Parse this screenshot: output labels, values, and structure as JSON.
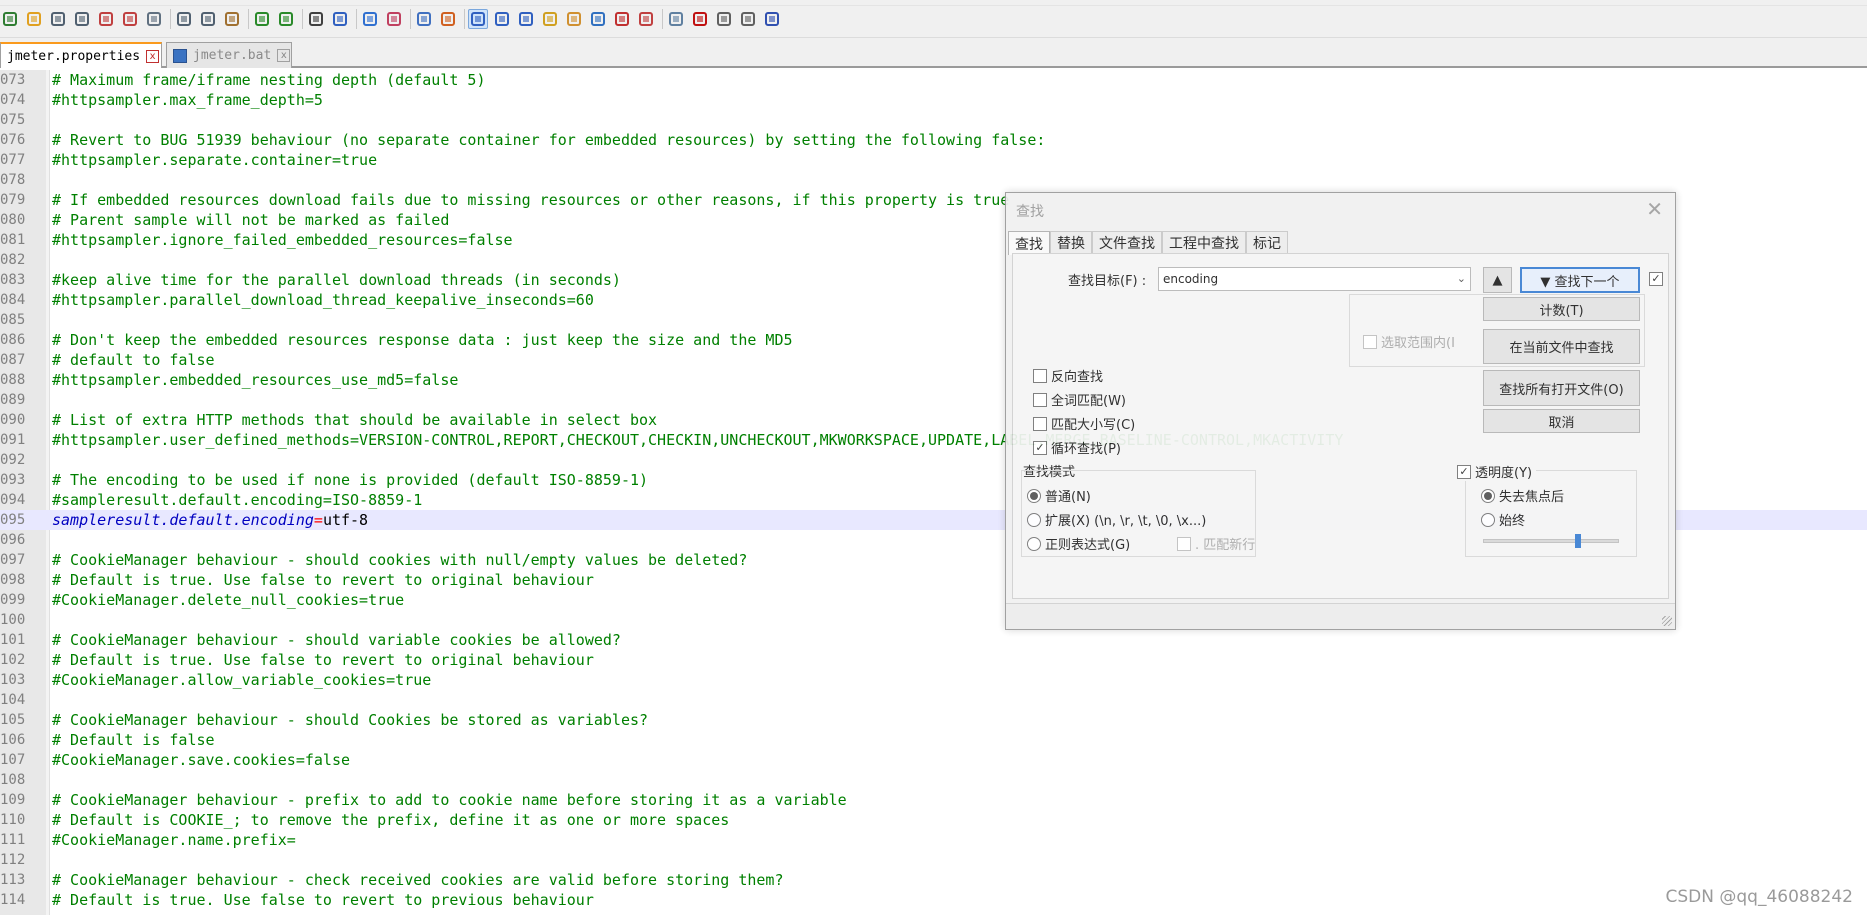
{
  "toolbar": {
    "icons": [
      "new-file-icon",
      "open-folder-icon",
      "save-icon",
      "save-all-icon",
      "close-icon",
      "close-all-icon",
      "print-icon",
      "cut-icon",
      "copy-icon",
      "paste-icon",
      "undo-icon",
      "redo-icon",
      "find-icon",
      "replace-icon",
      "zoom-in-icon",
      "zoom-out-icon",
      "sync-vertical-icon",
      "sync-horizontal-icon",
      "word-wrap-icon",
      "show-all-chars-icon",
      "indent-guide-icon",
      "language-icon",
      "doc-map-icon",
      "function-list-icon",
      "folder-workspace-icon",
      "monitor-icon",
      "record-macro-icon",
      "stop-macro-icon",
      "play-macro-icon",
      "run-macro-icon",
      "save-macro-icon"
    ]
  },
  "tabs": [
    {
      "label": "jmeter.properties",
      "active": true
    },
    {
      "label": "jmeter.bat",
      "active": false
    }
  ],
  "editor": {
    "lines": [
      {
        "n": "073",
        "text": "# Maximum frame/iframe nesting depth (default 5)"
      },
      {
        "n": "074",
        "text": "#httpsampler.max_frame_depth=5"
      },
      {
        "n": "075",
        "text": ""
      },
      {
        "n": "076",
        "text": "# Revert to BUG 51939 behaviour (no separate container for embedded resources) by setting the following false:"
      },
      {
        "n": "077",
        "text": "#httpsampler.separate.container=true"
      },
      {
        "n": "078",
        "text": ""
      },
      {
        "n": "079",
        "text": "# If embedded resources download fails due to missing resources or other reasons, if this property is true"
      },
      {
        "n": "080",
        "text": "# Parent sample will not be marked as failed"
      },
      {
        "n": "081",
        "text": "#httpsampler.ignore_failed_embedded_resources=false"
      },
      {
        "n": "082",
        "text": ""
      },
      {
        "n": "083",
        "text": "#keep alive time for the parallel download threads (in seconds)"
      },
      {
        "n": "084",
        "text": "#httpsampler.parallel_download_thread_keepalive_inseconds=60"
      },
      {
        "n": "085",
        "text": ""
      },
      {
        "n": "086",
        "text": "# Don't keep the embedded resources response data : just keep the size and the MD5"
      },
      {
        "n": "087",
        "text": "# default to false"
      },
      {
        "n": "088",
        "text": "#httpsampler.embedded_resources_use_md5=false"
      },
      {
        "n": "089",
        "text": ""
      },
      {
        "n": "090",
        "text": "# List of extra HTTP methods that should be available in select box"
      },
      {
        "n": "091",
        "text": "#httpsampler.user_defined_methods=VERSION-CONTROL,REPORT,CHECKOUT,CHECKIN,UNCHECKOUT,MKWORKSPACE,UPDATE,LABEL,MERGE,BASELINE-CONTROL,MKACTIVITY"
      },
      {
        "n": "092",
        "text": ""
      },
      {
        "n": "093",
        "text": "# The encoding to be used if none is provided (default ISO-8859-1)"
      },
      {
        "n": "094",
        "text": "#sampleresult.default.encoding=ISO-8859-1"
      },
      {
        "n": "095",
        "text": "",
        "key": "sampleresult.default.encoding",
        "eq": "=",
        "val": "utf-8",
        "current": true
      },
      {
        "n": "096",
        "text": ""
      },
      {
        "n": "097",
        "text": "# CookieManager behaviour - should cookies with null/empty values be deleted?"
      },
      {
        "n": "098",
        "text": "# Default is true. Use false to revert to original behaviour"
      },
      {
        "n": "099",
        "text": "#CookieManager.delete_null_cookies=true"
      },
      {
        "n": "100",
        "text": ""
      },
      {
        "n": "101",
        "text": "# CookieManager behaviour - should variable cookies be allowed?"
      },
      {
        "n": "102",
        "text": "# Default is true. Use false to revert to original behaviour"
      },
      {
        "n": "103",
        "text": "#CookieManager.allow_variable_cookies=true"
      },
      {
        "n": "104",
        "text": ""
      },
      {
        "n": "105",
        "text": "# CookieManager behaviour - should Cookies be stored as variables?"
      },
      {
        "n": "106",
        "text": "# Default is false"
      },
      {
        "n": "107",
        "text": "#CookieManager.save.cookies=false"
      },
      {
        "n": "108",
        "text": ""
      },
      {
        "n": "109",
        "text": "# CookieManager behaviour - prefix to add to cookie name before storing it as a variable"
      },
      {
        "n": "110",
        "text": "# Default is COOKIE_; to remove the prefix, define it as one or more spaces"
      },
      {
        "n": "111",
        "text": "#CookieManager.name.prefix="
      },
      {
        "n": "112",
        "text": ""
      },
      {
        "n": "113",
        "text": "# CookieManager behaviour - check received cookies are valid before storing them?"
      },
      {
        "n": "114",
        "text": "# Default is true. Use false to revert to previous behaviour"
      }
    ]
  },
  "find_dialog": {
    "title": "查找",
    "close_glyph": "✕",
    "tabs": [
      "查找",
      "替换",
      "文件查找",
      "工程中查找",
      "标记"
    ],
    "search_label": "查找目标(F) :",
    "search_value": "encoding",
    "btn_up": "▲",
    "btn_find_next": "▼ 查找下一个",
    "btn_count": "计数(T)",
    "in_selection": "选取范围内(I",
    "btn_find_in_current": "在当前文件中查找",
    "btn_find_all_open": "查找所有打开文件(O)",
    "btn_cancel": "取消",
    "opt_backward": "反向查找",
    "opt_whole_word": "全词匹配(W)",
    "opt_match_case": "匹配大小写(C)",
    "opt_wrap": "循环查找(P)",
    "mode_title": "查找模式",
    "mode_normal": "普通(N)",
    "mode_extended": "扩展(X) (\\n, \\r, \\t, \\0, \\x...)",
    "mode_regex": "正则表达式(G)",
    "regex_newline": ". 匹配新行",
    "transparency": "透明度(Y)",
    "trans_on_lose_focus": "失去焦点后",
    "trans_always": "始终",
    "transparency_level": 0.7
  },
  "watermark": "CSDN @qq_46088242"
}
